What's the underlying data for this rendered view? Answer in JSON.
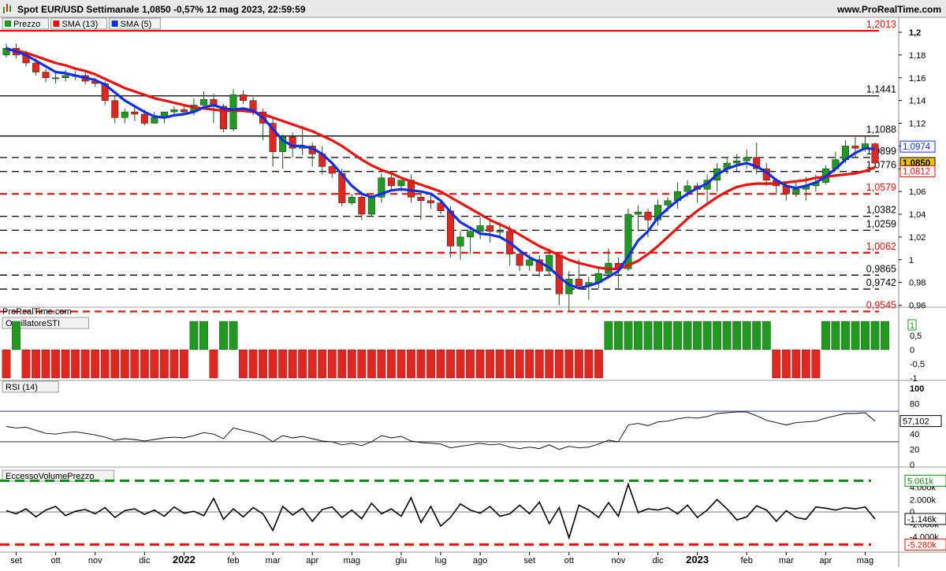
{
  "header": {
    "title": "Spot EUR/USD Settimanale 1,0850 -0,57% 12 mag 2023, 22:59:59",
    "brand": "www.ProRealTime.com"
  },
  "watermark": "ProRealTime.com",
  "colors": {
    "up": "#1f9a1f",
    "down": "#e0261f",
    "sma13": "#e8140c",
    "sma5": "#1030e0",
    "priceBadge": "#f2c200"
  },
  "chart_data": [
    {
      "type": "candlestick",
      "legend": [
        "Prezzo",
        "SMA (13)",
        "SMA (5)"
      ],
      "xlabel": "",
      "ylabel": "",
      "ylim": [
        0.95,
        1.2
      ],
      "yticks": [
        "1,2",
        "1,18",
        "1,16",
        "1,14",
        "1,12",
        "1,1",
        "1,08",
        "1,06",
        "1,04",
        "1,02",
        "1",
        "0,98",
        "0,96"
      ],
      "ytick_values": [
        1.2,
        1.18,
        1.16,
        1.14,
        1.12,
        1.1,
        1.08,
        1.06,
        1.04,
        1.02,
        1.0,
        0.98,
        0.96
      ],
      "months": [
        {
          "label": "set",
          "index": 1
        },
        {
          "label": "ott",
          "index": 5
        },
        {
          "label": "nov",
          "index": 9
        },
        {
          "label": "dic",
          "index": 14
        },
        {
          "label": "2022",
          "index": 18
        },
        {
          "label": "feb",
          "index": 23
        },
        {
          "label": "mar",
          "index": 27
        },
        {
          "label": "apr",
          "index": 31
        },
        {
          "label": "mag",
          "index": 35
        },
        {
          "label": "giu",
          "index": 40
        },
        {
          "label": "lug",
          "index": 44
        },
        {
          "label": "ago",
          "index": 48
        },
        {
          "label": "set",
          "index": 53
        },
        {
          "label": "ott",
          "index": 57
        },
        {
          "label": "nov",
          "index": 62
        },
        {
          "label": "dic",
          "index": 66
        },
        {
          "label": "2023",
          "index": 70
        },
        {
          "label": "feb",
          "index": 75
        },
        {
          "label": "mar",
          "index": 79
        },
        {
          "label": "apr",
          "index": 83
        },
        {
          "label": "mag",
          "index": 87
        }
      ],
      "levels": [
        {
          "value": 1.2013,
          "label": "1,2013",
          "color": "#e8140c",
          "style": "solid"
        },
        {
          "value": 1.1441,
          "label": "1,1441",
          "color": "#000000",
          "style": "solid"
        },
        {
          "value": 1.1088,
          "label": "1,1088",
          "color": "#000000",
          "style": "solid"
        },
        {
          "value": 1.0899,
          "label": "1,0899",
          "color": "#000000",
          "style": "dashed"
        },
        {
          "value": 1.0776,
          "label": "1,0776",
          "color": "#000000",
          "style": "dashed"
        },
        {
          "value": 1.0579,
          "label": "1,0579",
          "color": "#e8140c",
          "style": "dashed"
        },
        {
          "value": 1.0382,
          "label": "1,0382",
          "color": "#000000",
          "style": "dashed"
        },
        {
          "value": 1.0259,
          "label": "1,0259",
          "color": "#000000",
          "style": "dashed"
        },
        {
          "value": 1.0062,
          "label": "1,0062",
          "color": "#e8140c",
          "style": "dashed"
        },
        {
          "value": 0.9865,
          "label": "0,9865",
          "color": "#000000",
          "style": "dashed"
        },
        {
          "value": 0.9742,
          "label": "0,9742",
          "color": "#000000",
          "style": "dashed"
        },
        {
          "value": 0.9545,
          "label": "0,9545",
          "color": "#e8140c",
          "style": "dashed"
        }
      ],
      "badges": [
        {
          "value": 1.0974,
          "label": "1,0974",
          "kind": "sma5"
        },
        {
          "value": 1.085,
          "label": "1,0850",
          "kind": "price"
        },
        {
          "value": 1.0812,
          "label": "1,0812",
          "kind": "sma13"
        }
      ],
      "close": [
        1.186,
        1.18,
        1.173,
        1.165,
        1.16,
        1.16,
        1.162,
        1.162,
        1.157,
        1.155,
        1.14,
        1.125,
        1.13,
        1.128,
        1.12,
        1.125,
        1.13,
        1.132,
        1.13,
        1.136,
        1.141,
        1.135,
        1.115,
        1.145,
        1.14,
        1.13,
        1.12,
        1.095,
        1.108,
        1.098,
        1.1,
        1.093,
        1.082,
        1.076,
        1.05,
        1.055,
        1.04,
        1.055,
        1.072,
        1.065,
        1.07,
        1.055,
        1.052,
        1.05,
        1.043,
        1.012,
        1.02,
        1.025,
        1.03,
        1.025,
        1.025,
        1.005,
        0.995,
        1.0,
        0.99,
        1.004,
        0.97,
        0.983,
        0.977,
        0.98,
        0.988,
        0.997,
        0.992,
        1.04,
        1.042,
        1.035,
        1.048,
        1.052,
        1.06,
        1.065,
        1.062,
        1.07,
        1.08,
        1.085,
        1.087,
        1.09,
        1.08,
        1.07,
        1.065,
        1.058,
        1.062,
        1.065,
        1.068,
        1.08,
        1.088,
        1.1,
        1.098,
        1.102,
        1.085
      ],
      "open": [
        1.18,
        1.186,
        1.18,
        1.173,
        1.165,
        1.16,
        1.16,
        1.162,
        1.162,
        1.157,
        1.155,
        1.14,
        1.125,
        1.13,
        1.128,
        1.12,
        1.125,
        1.13,
        1.132,
        1.13,
        1.136,
        1.141,
        1.135,
        1.115,
        1.145,
        1.14,
        1.13,
        1.12,
        1.095,
        1.108,
        1.098,
        1.1,
        1.093,
        1.082,
        1.076,
        1.05,
        1.055,
        1.04,
        1.055,
        1.072,
        1.065,
        1.07,
        1.055,
        1.052,
        1.05,
        1.043,
        1.012,
        1.02,
        1.025,
        1.03,
        1.025,
        1.025,
        1.005,
        0.995,
        1.0,
        0.99,
        1.004,
        0.97,
        0.983,
        0.977,
        0.98,
        0.988,
        0.997,
        0.992,
        1.04,
        1.042,
        1.035,
        1.048,
        1.052,
        1.06,
        1.065,
        1.062,
        1.07,
        1.08,
        1.085,
        1.087,
        1.09,
        1.08,
        1.07,
        1.065,
        1.058,
        1.062,
        1.065,
        1.068,
        1.08,
        1.088,
        1.1,
        1.098,
        1.102
      ],
      "high": [
        1.19,
        1.19,
        1.184,
        1.177,
        1.168,
        1.166,
        1.167,
        1.166,
        1.167,
        1.16,
        1.157,
        1.144,
        1.133,
        1.135,
        1.132,
        1.13,
        1.13,
        1.135,
        1.136,
        1.142,
        1.148,
        1.146,
        1.137,
        1.15,
        1.149,
        1.143,
        1.133,
        1.124,
        1.11,
        1.112,
        1.118,
        1.103,
        1.1,
        1.085,
        1.08,
        1.058,
        1.06,
        1.058,
        1.076,
        1.078,
        1.07,
        1.075,
        1.06,
        1.057,
        1.052,
        1.047,
        1.025,
        1.028,
        1.037,
        1.035,
        1.033,
        1.03,
        1.008,
        1.005,
        1.004,
        1.01,
        1.005,
        0.99,
        1.0,
        0.985,
        0.993,
        1.01,
        1.002,
        1.045,
        1.048,
        1.045,
        1.053,
        1.055,
        1.068,
        1.07,
        1.068,
        1.075,
        1.085,
        1.09,
        1.093,
        1.097,
        1.103,
        1.085,
        1.072,
        1.068,
        1.068,
        1.073,
        1.075,
        1.083,
        1.095,
        1.105,
        1.108,
        1.109,
        1.103
      ],
      "low": [
        1.178,
        1.177,
        1.17,
        1.162,
        1.156,
        1.155,
        1.157,
        1.158,
        1.154,
        1.152,
        1.136,
        1.12,
        1.12,
        1.122,
        1.118,
        1.12,
        1.12,
        1.128,
        1.127,
        1.127,
        1.132,
        1.12,
        1.112,
        1.113,
        1.137,
        1.127,
        1.105,
        1.082,
        1.08,
        1.09,
        1.092,
        1.082,
        1.075,
        1.072,
        1.047,
        1.048,
        1.035,
        1.038,
        1.05,
        1.062,
        1.06,
        1.05,
        1.035,
        1.045,
        1.04,
        1.002,
        1.0,
        1.005,
        1.018,
        1.015,
        1.02,
        0.995,
        0.99,
        0.99,
        0.985,
        0.987,
        0.96,
        0.955,
        0.975,
        0.965,
        0.975,
        0.983,
        0.975,
        0.99,
        1.025,
        1.02,
        1.03,
        1.042,
        1.045,
        1.055,
        1.05,
        1.048,
        1.06,
        1.075,
        1.078,
        1.08,
        1.075,
        1.065,
        1.057,
        1.052,
        1.055,
        1.052,
        1.06,
        1.066,
        1.078,
        1.085,
        1.09,
        1.095,
        1.08
      ],
      "sma13": [
        1.185,
        1.184,
        1.182,
        1.179,
        1.176,
        1.173,
        1.171,
        1.168,
        1.166,
        1.163,
        1.159,
        1.155,
        1.151,
        1.148,
        1.145,
        1.142,
        1.14,
        1.138,
        1.136,
        1.134,
        1.133,
        1.132,
        1.131,
        1.131,
        1.131,
        1.13,
        1.128,
        1.125,
        1.122,
        1.119,
        1.116,
        1.113,
        1.109,
        1.105,
        1.1,
        1.094,
        1.088,
        1.083,
        1.079,
        1.076,
        1.072,
        1.069,
        1.066,
        1.063,
        1.06,
        1.055,
        1.05,
        1.045,
        1.04,
        1.035,
        1.031,
        1.027,
        1.022,
        1.017,
        1.012,
        1.008,
        1.004,
        1.0,
        0.997,
        0.995,
        0.993,
        0.992,
        0.992,
        0.995,
        0.999,
        1.005,
        1.012,
        1.02,
        1.028,
        1.036,
        1.043,
        1.049,
        1.055,
        1.06,
        1.064,
        1.066,
        1.067,
        1.067,
        1.067,
        1.068,
        1.069,
        1.07,
        1.072,
        1.073,
        1.074,
        1.075,
        1.076,
        1.078,
        1.0812
      ],
      "sma5": [
        1.186,
        1.183,
        1.18,
        1.175,
        1.17,
        1.165,
        1.164,
        1.162,
        1.16,
        1.158,
        1.154,
        1.147,
        1.14,
        1.135,
        1.13,
        1.126,
        1.125,
        1.127,
        1.128,
        1.13,
        1.134,
        1.136,
        1.133,
        1.132,
        1.133,
        1.131,
        1.125,
        1.115,
        1.105,
        1.1,
        1.1,
        1.098,
        1.093,
        1.085,
        1.075,
        1.065,
        1.058,
        1.055,
        1.058,
        1.061,
        1.062,
        1.061,
        1.06,
        1.058,
        1.052,
        1.042,
        1.033,
        1.028,
        1.023,
        1.022,
        1.02,
        1.015,
        1.008,
        1.002,
        0.998,
        0.993,
        0.985,
        0.978,
        0.975,
        0.977,
        0.98,
        0.985,
        0.99,
        1.003,
        1.017,
        1.025,
        1.037,
        1.045,
        1.052,
        1.058,
        1.063,
        1.067,
        1.075,
        1.08,
        1.083,
        1.085,
        1.082,
        1.077,
        1.07,
        1.065,
        1.063,
        1.065,
        1.068,
        1.073,
        1.08,
        1.088,
        1.094,
        1.098,
        1.0974
      ]
    },
    {
      "type": "bar",
      "legend": [
        "OscillatoreSTI"
      ],
      "ylim": [
        -1,
        1
      ],
      "yticks": [
        "1",
        "0,5",
        "0",
        "-0,5",
        "-1"
      ],
      "ytick_values": [
        1,
        0.5,
        0,
        -0.5,
        -1
      ],
      "badge": "1",
      "values": [
        -1,
        1,
        -1,
        -1,
        -1,
        -1,
        -1,
        -1,
        -1,
        -1,
        -1,
        -1,
        -1,
        -1,
        -1,
        -1,
        -1,
        -1,
        -1,
        1,
        1,
        -1,
        1,
        1,
        -1,
        -1,
        -1,
        -1,
        -1,
        -1,
        -1,
        -1,
        -1,
        -1,
        -1,
        -1,
        -1,
        -1,
        -1,
        -1,
        -1,
        -1,
        -1,
        -1,
        -1,
        -1,
        -1,
        -1,
        -1,
        -1,
        -1,
        -1,
        -1,
        -1,
        -1,
        -1,
        -1,
        -1,
        -1,
        -1,
        -1,
        1,
        1,
        1,
        1,
        1,
        1,
        1,
        1,
        1,
        1,
        1,
        1,
        1,
        1,
        1,
        1,
        1,
        -1,
        -1,
        -1,
        -1,
        -1,
        1,
        1,
        1,
        1,
        1,
        1,
        1
      ]
    },
    {
      "type": "line",
      "legend": [
        "RSI (14)"
      ],
      "ylim": [
        0,
        100
      ],
      "yticks": [
        "100",
        "80",
        "60",
        "40",
        "20",
        "0"
      ],
      "ytick_values": [
        100,
        80,
        60,
        40,
        20,
        0
      ],
      "bands": [
        70,
        30
      ],
      "badge": "57,102",
      "values": [
        50,
        48,
        49,
        45,
        41,
        40,
        42,
        43,
        41,
        39,
        36,
        32,
        34,
        33,
        31,
        33,
        35,
        36,
        35,
        38,
        42,
        40,
        34,
        48,
        45,
        42,
        38,
        30,
        38,
        35,
        37,
        34,
        31,
        30,
        26,
        28,
        25,
        30,
        38,
        35,
        37,
        31,
        29,
        28,
        27,
        22,
        24,
        26,
        28,
        26,
        27,
        23,
        21,
        23,
        21,
        26,
        20,
        24,
        22,
        23,
        27,
        32,
        30,
        52,
        54,
        51,
        56,
        57,
        60,
        62,
        61,
        63,
        67,
        68,
        69,
        69,
        64,
        58,
        55,
        52,
        55,
        56,
        57,
        61,
        64,
        67,
        67,
        68,
        57.102
      ]
    },
    {
      "type": "line",
      "legend": [
        "EccessoVolumePrezzo"
      ],
      "ylim": [
        -6000,
        6000
      ],
      "yticks": [
        "4.000k",
        "2.000k",
        "0",
        "-2.000k",
        "-4.000k"
      ],
      "ytick_values": [
        4000,
        2000,
        0,
        -2000,
        -4000
      ],
      "bands": [
        5061,
        -5280
      ],
      "band_labels": [
        "5.061k",
        "-5.280k"
      ],
      "badge": "-1.146k",
      "values": [
        200,
        -300,
        500,
        -800,
        300,
        900,
        -600,
        100,
        400,
        -300,
        700,
        -900,
        200,
        500,
        -400,
        300,
        -700,
        800,
        -200,
        100,
        -600,
        2200,
        -1200,
        500,
        -800,
        700,
        -300,
        -3000,
        900,
        -500,
        600,
        -1500,
        400,
        800,
        -900,
        300,
        -1100,
        1400,
        -300,
        500,
        -700,
        2300,
        -1700,
        900,
        -2300,
        -900,
        1300,
        300,
        -200,
        900,
        -700,
        -300,
        1100,
        -300,
        1600,
        -1900,
        700,
        -4200,
        1100,
        300,
        -900,
        1500,
        -700,
        4500,
        -100,
        500,
        300,
        700,
        -300,
        1100,
        -900,
        300,
        2000,
        500,
        -1300,
        -800,
        1000,
        300,
        -1500,
        200,
        -900,
        -1200,
        800,
        600,
        300,
        700,
        500,
        800,
        -1146
      ]
    }
  ]
}
